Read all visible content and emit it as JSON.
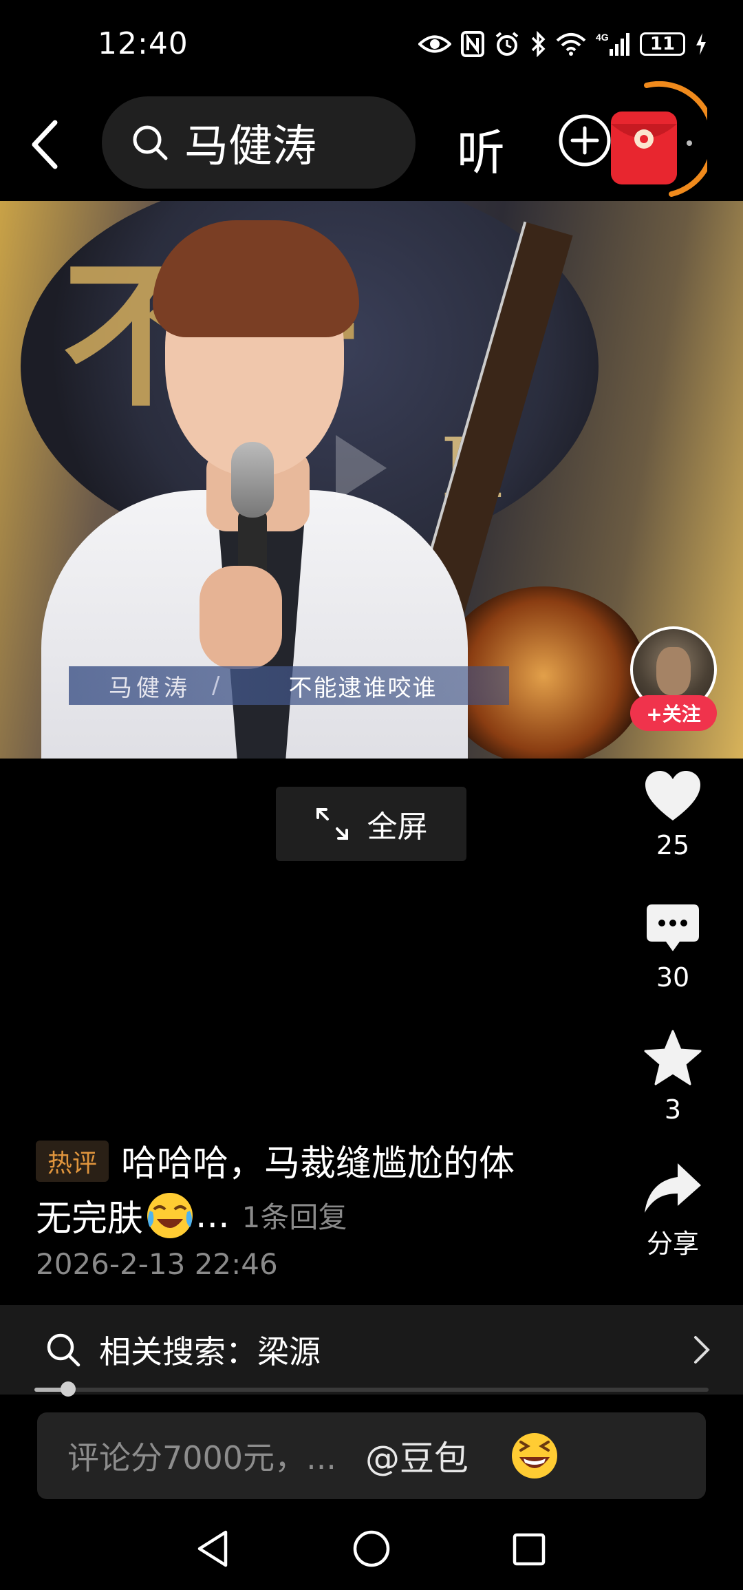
{
  "status_bar": {
    "time": "12:40",
    "network": "4G",
    "battery": "11"
  },
  "top_bar": {
    "search_query": "马健涛",
    "listen_label": "听"
  },
  "video": {
    "caption_name": "马健涛",
    "caption_sep": "/",
    "caption_line": "不能逮谁咬谁",
    "fullscreen_label": "全屏"
  },
  "author": {
    "follow_label": "+关注"
  },
  "actions": {
    "likes": "25",
    "comments": "30",
    "favorites": "3",
    "share_label": "分享"
  },
  "hot_comment": {
    "tag": "热评",
    "line1": "哈哈哈，马裁缝尴尬的体",
    "line2": "无完肤",
    "ellipsis": "...",
    "replies": "1条回复",
    "date": "2026-2-13 22:46"
  },
  "related_search": {
    "label": "相关搜索：梁源"
  },
  "video_progress": 0.05,
  "comment_input": {
    "placeholder": "评论分7000元，...",
    "mention": "@豆包"
  },
  "colors": {
    "follow_red": "#f0334c",
    "hot_tag_text": "#e0953d",
    "ring_orange": "#f08a1c",
    "redpack": "#e8262f"
  }
}
